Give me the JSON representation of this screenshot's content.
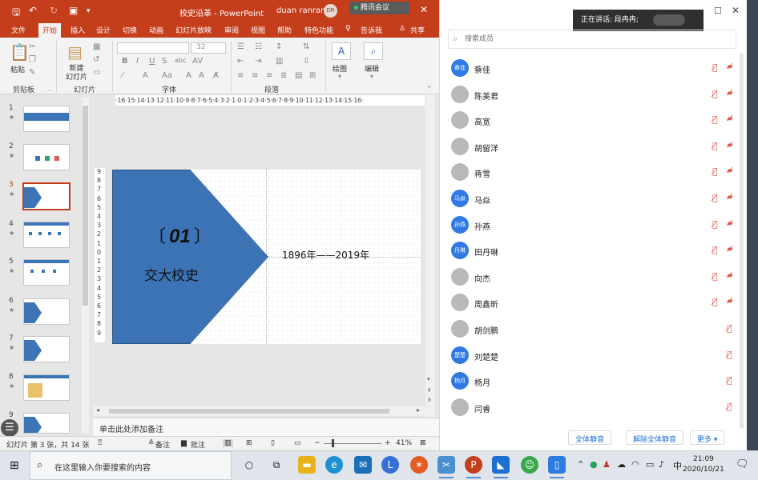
{
  "ppt": {
    "doc_title": "校史沿革  -  PowerPoint",
    "user_name": "duan ranran",
    "user_initials": "DR",
    "meeting_chip": "腾讯会议",
    "close": "✕",
    "tabs": [
      "文件",
      "开始",
      "插入",
      "设计",
      "切换",
      "动画",
      "幻灯片放映",
      "审阅",
      "视图",
      "帮助",
      "特色功能",
      "告诉我",
      "共享"
    ],
    "active_tab": "开始",
    "ribbon": {
      "paste": "粘贴",
      "new_slide": "新建\n幻灯片",
      "font_size": "32",
      "draw": "绘图",
      "edit": "编辑",
      "groups": [
        "剪贴板",
        "幻灯片",
        "字体",
        "段落"
      ]
    },
    "thumbnails": [
      "1",
      "2",
      "3",
      "4",
      "5",
      "6",
      "7",
      "8",
      "9"
    ],
    "selected_thumbnail": "3",
    "ruler_h": "·16·15·14·13·12·11·10·9·8·7·6·5·4·3·2·1·0·1·2·3·4·5·6·7·8·9·10·11·12·13·14·15·16·",
    "ruler_v": [
      "9",
      "8",
      "7",
      "6",
      "5",
      "4",
      "3",
      "2",
      "1",
      "0",
      "1",
      "2",
      "3",
      "4",
      "5",
      "6",
      "7",
      "8",
      "9"
    ],
    "slide": {
      "bracket_left": "〔",
      "number": "01",
      "bracket_right": "〕",
      "heading": "交大校史",
      "years": "1896年——2019年",
      "shape_color": "#3c73b5"
    },
    "notes_placeholder": "单击此处添加备注",
    "status": {
      "slide_info": "幻灯片 第 3 张，共 14 张",
      "notes": "备注",
      "comments": "批注",
      "zoom": "41%"
    }
  },
  "meeting": {
    "speaking": "正在讲话: 段冉冉;",
    "search_placeholder": "搜索成员",
    "members": [
      {
        "name": "蔡佳",
        "avatar_text": "蔡佳",
        "avatar": "text",
        "cam": true
      },
      {
        "name": "陈美君",
        "avatar_text": "",
        "avatar": "image",
        "cam": true
      },
      {
        "name": "高宽",
        "avatar_text": "",
        "avatar": "image",
        "cam": true
      },
      {
        "name": "胡留洋",
        "avatar_text": "",
        "avatar": "image",
        "cam": true
      },
      {
        "name": "蒋雪",
        "avatar_text": "",
        "avatar": "image",
        "cam": true
      },
      {
        "name": "马焱",
        "avatar_text": "马焱",
        "avatar": "text",
        "cam": true
      },
      {
        "name": "孙燕",
        "avatar_text": "孙燕",
        "avatar": "text",
        "cam": true
      },
      {
        "name": "田丹琳",
        "avatar_text": "丹琳",
        "avatar": "text",
        "cam": true
      },
      {
        "name": "向杰",
        "avatar_text": "",
        "avatar": "image",
        "cam": true
      },
      {
        "name": "周鑫昕",
        "avatar_text": "",
        "avatar": "image",
        "cam": true
      },
      {
        "name": "胡剑鹏",
        "avatar_text": "",
        "avatar": "image",
        "cam": false
      },
      {
        "name": "刘楚楚",
        "avatar_text": "楚楚",
        "avatar": "text",
        "cam": false
      },
      {
        "name": "杨月",
        "avatar_text": "杨月",
        "avatar": "text",
        "cam": false
      },
      {
        "name": "闫睿",
        "avatar_text": "",
        "avatar": "image",
        "cam": false
      }
    ],
    "buttons": {
      "mute_all": "全体静音",
      "unmute_all": "解除全体静音",
      "more": "更多 ▾"
    }
  },
  "taskbar": {
    "search_placeholder": "在这里输入你要搜索的内容",
    "ime": "中",
    "time": "21:09",
    "date": "2020/10/21"
  },
  "colors": {
    "ppt_accent": "#c43e1c",
    "meeting_blue": "#2f7ae5",
    "muted_red": "#e05a4f"
  }
}
